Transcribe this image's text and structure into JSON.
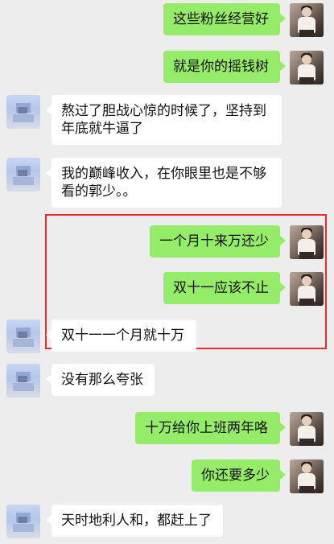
{
  "conversation": {
    "messages": [
      {
        "side": "right",
        "text": "这些粉丝经营好"
      },
      {
        "side": "right",
        "text": "就是你的摇钱树"
      },
      {
        "side": "left",
        "text_lines": [
          "熬过了胆战心惊的时候了，坚持到",
          "年底就牛逼了"
        ]
      },
      {
        "side": "left",
        "text_lines": [
          "我的巅峰收入，在你眼里也是不够",
          "看的郭少。。"
        ]
      },
      {
        "side": "right",
        "text": "一个月十来万还少"
      },
      {
        "side": "right",
        "text": "双十一应该不止"
      },
      {
        "side": "left",
        "text": "双十一一个月就十万"
      },
      {
        "side": "left",
        "text": "没有那么夸张"
      },
      {
        "side": "right",
        "text": "十万给你上班两年咯"
      },
      {
        "side": "right",
        "text": "你还要多少"
      },
      {
        "side": "left",
        "text": "天时地利人和，都赶上了"
      }
    ]
  },
  "colors": {
    "background": "#ededed",
    "self_bubble": "#95ec69",
    "other_bubble": "#ffffff",
    "highlight_box": "#ee2b2b"
  }
}
